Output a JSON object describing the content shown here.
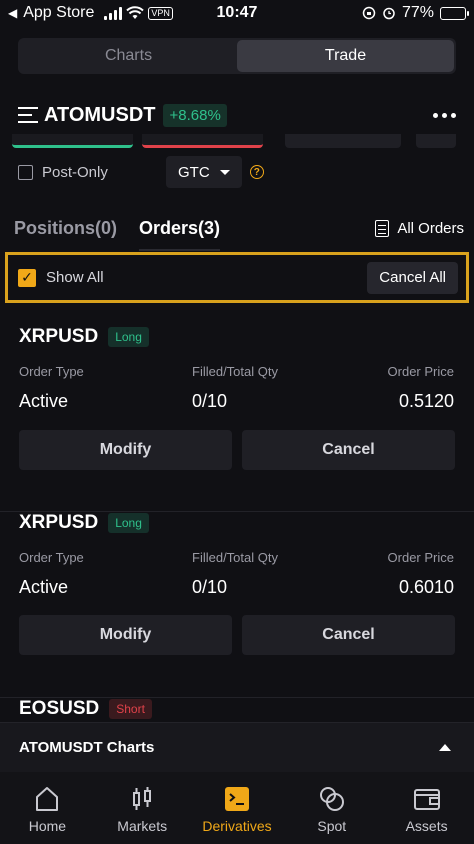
{
  "status_bar": {
    "back_label": "App Store",
    "vpn": "VPN",
    "time": "10:47",
    "battery": "77%",
    "battery_level": 0.77
  },
  "segment": {
    "tabs": [
      {
        "label": "Charts",
        "active": false
      },
      {
        "label": "Trade",
        "active": true
      }
    ]
  },
  "header": {
    "symbol": "ATOMUSDT",
    "change": "+8.68%"
  },
  "options": {
    "post_only": "Post-Only",
    "time_in_force": "GTC"
  },
  "tabs": {
    "positions": "Positions(0)",
    "orders": "Orders(3)",
    "all_orders": "All Orders"
  },
  "showall": {
    "label": "Show All",
    "checked": true,
    "cancel_all": "Cancel All"
  },
  "order_labels": {
    "type": "Order Type",
    "qty": "Filled/Total Qty",
    "price": "Order Price",
    "modify": "Modify",
    "cancel": "Cancel"
  },
  "orders": [
    {
      "symbol": "XRPUSD",
      "side": "Long",
      "type": "Active",
      "qty": "0/10",
      "price": "0.5120"
    },
    {
      "symbol": "XRPUSD",
      "side": "Long",
      "type": "Active",
      "qty": "0/10",
      "price": "0.6010"
    },
    {
      "symbol": "EOSUSD",
      "side": "Short"
    }
  ],
  "charts_bar": {
    "title": "ATOMUSDT Charts"
  },
  "bottom_nav": [
    {
      "label": "Home",
      "icon": "home-icon"
    },
    {
      "label": "Markets",
      "icon": "candlestick-icon"
    },
    {
      "label": "Derivatives",
      "icon": "derivatives-icon",
      "active": true
    },
    {
      "label": "Spot",
      "icon": "spot-icon"
    },
    {
      "label": "Assets",
      "icon": "wallet-icon"
    }
  ],
  "colors": {
    "accent": "#f0a818",
    "long": "#2fc18c",
    "short": "#e0424a",
    "background": "#101014"
  }
}
